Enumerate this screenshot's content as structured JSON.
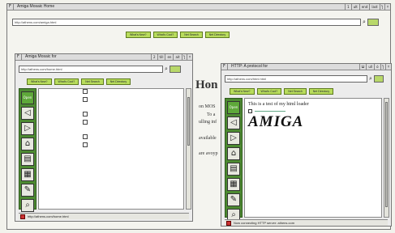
{
  "main_window": {
    "title": "Amiga Mosaic Home",
    "close": "F",
    "gadgets": [
      "1",
      "ult",
      "end",
      "last",
      "ƪ",
      "ʭ"
    ],
    "url": "http://athens.com/amiga.html",
    "nav": [
      "What's New?",
      "What's Cool?",
      "Net Search",
      "Net Directory"
    ]
  },
  "left_window": {
    "title": "Amiga Mosaic for",
    "close": "F",
    "gadgets": [
      "2",
      "till",
      "en",
      "ait",
      "ƪ",
      "ʭ"
    ],
    "url": "http://athens.com/home.html",
    "nav": [
      "What's New?",
      "What's Cool?",
      "Net Search",
      "Net Directory"
    ],
    "open_label": "Open",
    "status": "http://athens.com/home.html"
  },
  "right_window": {
    "title": "HTTP: A protocol for",
    "close": "F",
    "gadgets": [
      "Ѡ",
      "ull",
      "ȯ",
      "ƪ",
      "ʭ"
    ],
    "url": "http://athens.com/html.html",
    "nav": [
      "What's New?",
      "What's Cool?",
      "Net Search",
      "Net Directory"
    ],
    "open_label": "Open",
    "line1": "This is a test of my html loader",
    "amiga": "AMIGA",
    "status": "Now connecting HTTP server: athens.com"
  },
  "desktop": {
    "bg_heading": "Hon",
    "bg_lines": [
      "on MOS",
      "To a",
      "ulling inf",
      "available",
      "are avoyp"
    ]
  },
  "toolbar_icons": [
    "open",
    "back",
    "forward",
    "home",
    "save",
    "print",
    "search-doc",
    "find"
  ]
}
